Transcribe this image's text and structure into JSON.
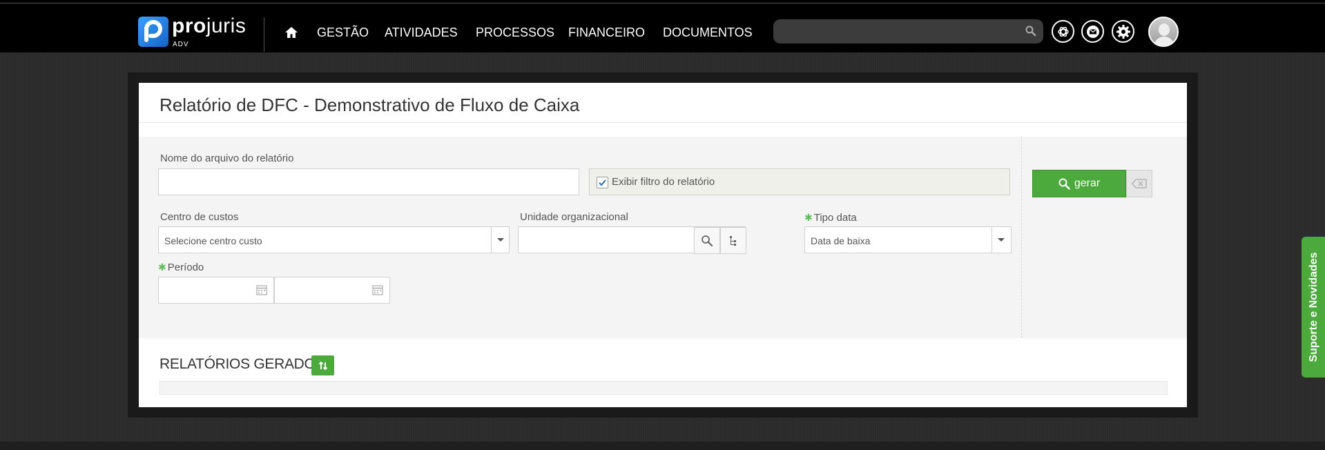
{
  "brand": {
    "name_bold": "pro",
    "name_light": "juris",
    "sub": "ADV"
  },
  "nav": {
    "items": [
      "GESTÃO",
      "ATIVIDADES",
      "PROCESSOS",
      "FINANCEIRO",
      "DOCUMENTOS"
    ],
    "search_value": ""
  },
  "page": {
    "title": "Relatório de DFC - Demonstrativo de Fluxo de Caixa"
  },
  "form": {
    "file_name": {
      "label": "Nome do arquivo do relatório",
      "value": ""
    },
    "show_filter": {
      "label": "Exibir filtro do relatório",
      "checked": true
    },
    "cost_center": {
      "label": "Centro de custos",
      "value": "Selecione centro custo"
    },
    "org_unit": {
      "label": "Unidade organizacional",
      "value": ""
    },
    "date_type": {
      "label": "Tipo data",
      "value": "Data de baixa"
    },
    "period": {
      "label": "Período",
      "start": "",
      "end": ""
    },
    "generate_label": "gerar"
  },
  "generated": {
    "title": "RELATÓRIOS GERADOS"
  },
  "support_tab": "Suporte e Novidades",
  "colors": {
    "accent_green": "#4caa3c",
    "navbar": "#000000",
    "logo_blue": "#1e7fe6"
  }
}
